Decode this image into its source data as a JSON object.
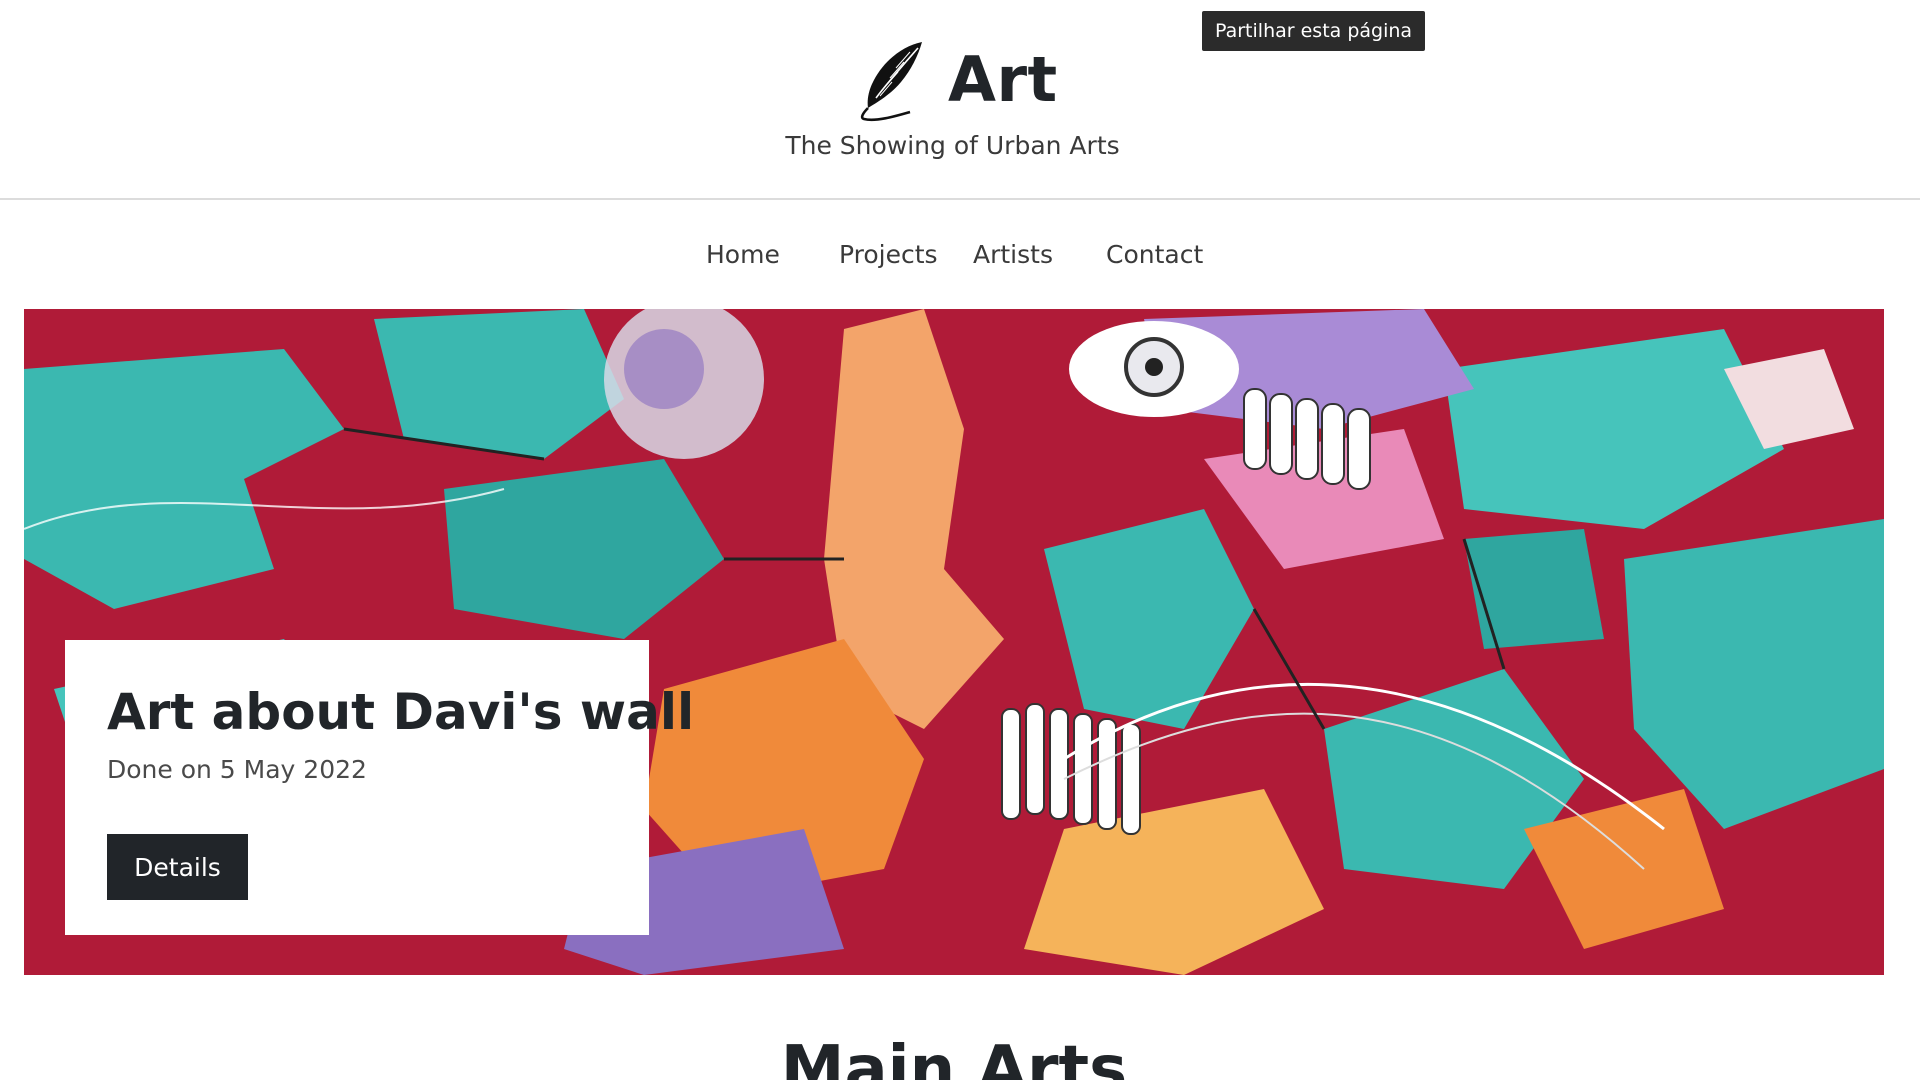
{
  "header": {
    "title": "Art",
    "tagline": "The Showing of Urban Arts",
    "logo_icon": "feather-quill-icon"
  },
  "share_tooltip": "Partilhar esta página",
  "nav": {
    "items": [
      {
        "label": "Home"
      },
      {
        "label": "Projects"
      },
      {
        "label": "Artists"
      },
      {
        "label": "Contact"
      }
    ]
  },
  "hero": {
    "image": "graffiti-mural-image",
    "title": "Art about Davi's wall",
    "date": "Done on 5 May 2022",
    "button_label": "Details"
  },
  "main": {
    "section_title": "Main Arts"
  },
  "colors": {
    "text": "#212529",
    "button_bg": "#212529",
    "tooltip_bg": "#2b2b2b",
    "mural_teal": "#3bb8b0",
    "mural_red": "#c4203d",
    "mural_orange": "#f08a3a",
    "mural_purple": "#8a6fc0"
  }
}
